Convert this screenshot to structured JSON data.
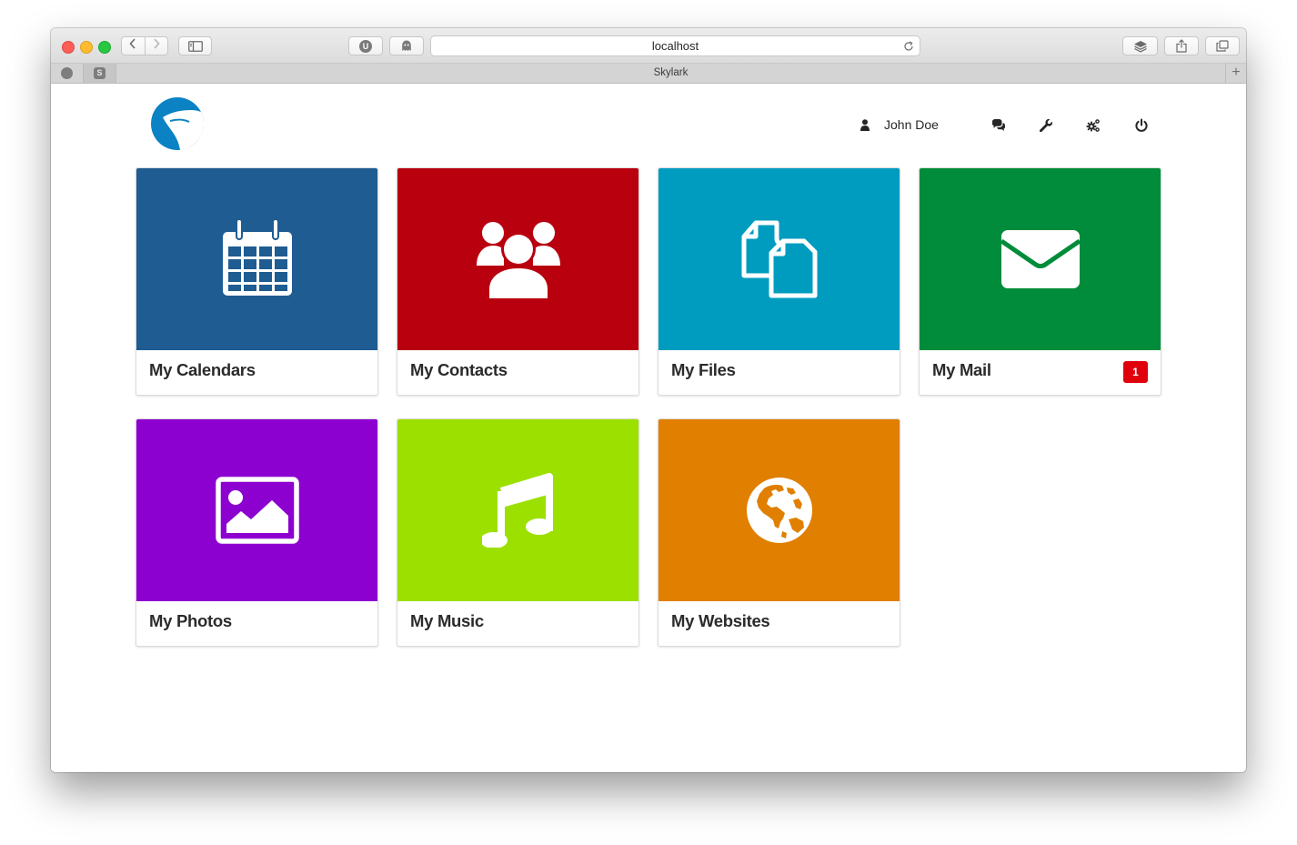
{
  "browser": {
    "url": "localhost",
    "tab_title": "Skylark",
    "pinned_tabs": [
      {
        "icon": "github-icon",
        "glyph": ""
      },
      {
        "icon": "skylark-s-icon",
        "glyph": "S"
      }
    ],
    "extensions": [
      {
        "icon": "ublock-icon",
        "glyph": "U"
      },
      {
        "icon": "ghostery-icon",
        "glyph": ""
      }
    ],
    "new_tab_label": "+"
  },
  "header": {
    "user_name": "John Doe",
    "icons": [
      "user-icon",
      "chat-icon",
      "wrench-icon",
      "gears-icon",
      "power-icon"
    ]
  },
  "colors": {
    "calendars": "#1e5c91",
    "contacts": "#b8000f",
    "files": "#009cc0",
    "mail": "#008c3a",
    "photos": "#8c00d0",
    "music": "#9ce000",
    "websites": "#e07f00",
    "badge": "#e0000b",
    "logo": "#0a82c4"
  },
  "tiles": [
    {
      "label": "My Calendars",
      "icon": "calendar-icon"
    },
    {
      "label": "My Contacts",
      "icon": "users-icon"
    },
    {
      "label": "My Files",
      "icon": "files-icon"
    },
    {
      "label": "My Mail",
      "icon": "envelope-icon",
      "badge": "1"
    },
    {
      "label": "My Photos",
      "icon": "picture-icon"
    },
    {
      "label": "My Music",
      "icon": "music-note-icon"
    },
    {
      "label": "My Websites",
      "icon": "globe-icon"
    }
  ]
}
